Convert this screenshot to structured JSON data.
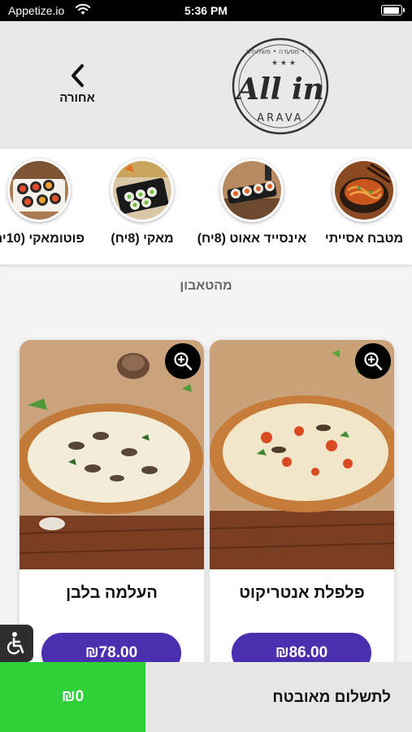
{
  "status_bar": {
    "carrier": "Appetize.io",
    "time": "5:36 PM"
  },
  "header": {
    "back_label": "אחורה",
    "logo": {
      "main": "All in",
      "sub": "ARAVA",
      "tagline": "בר • מסעדה • משלוחים"
    }
  },
  "categories": [
    {
      "label": "מטבח אסייתי",
      "icon": "noodle-bowl-thumbnail"
    },
    {
      "label": "אינסייד אאוט (8יח)",
      "icon": "inside-out-roll-thumbnail"
    },
    {
      "label": "מאקי (8יח)",
      "icon": "maki-roll-thumbnail"
    },
    {
      "label": "פוטומאקי (10יח",
      "icon": "futomaki-roll-thumbnail"
    }
  ],
  "section": {
    "title": "מהטאבון"
  },
  "products": [
    {
      "name": "פלפלת אנטריקוט",
      "price": "₪86.00",
      "image": "steak-pepper-pizza"
    },
    {
      "name": "העלמה בלבן",
      "price": "₪78.00",
      "image": "white-mushroom-pizza"
    }
  ],
  "bottom_bar": {
    "cart_total": "₪0",
    "checkout_label": "לתשלום מאובטח"
  },
  "colors": {
    "accent": "#4a2fae",
    "cart": "#2fd13a",
    "header_bg": "#e9e9e9"
  }
}
